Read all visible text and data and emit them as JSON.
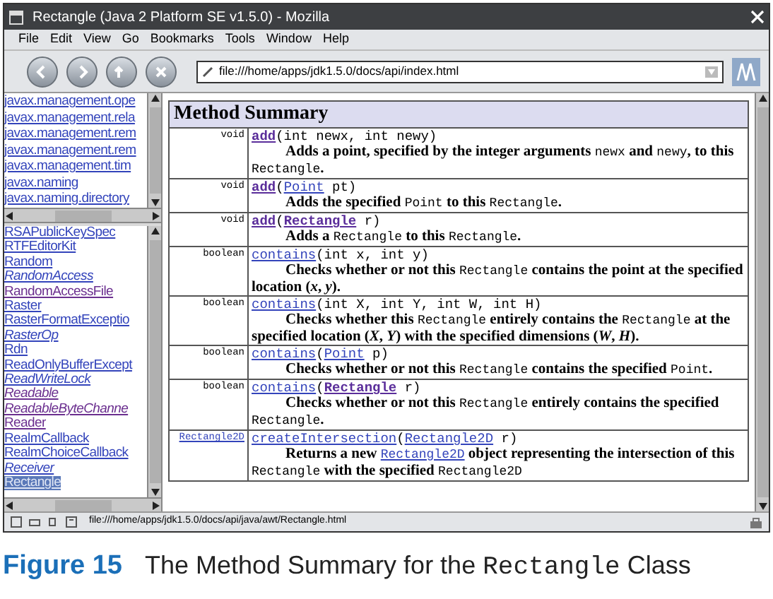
{
  "window": {
    "title": "Rectangle (Java 2 Platform SE v1.5.0) - Mozilla"
  },
  "menu": [
    "File",
    "Edit",
    "View",
    "Go",
    "Bookmarks",
    "Tools",
    "Window",
    "Help"
  ],
  "address_bar": {
    "value": "file:///home/apps/jdk1.5.0/docs/api/index.html"
  },
  "packages": [
    {
      "text": "javax.management.ope"
    },
    {
      "text": "javax.management.rela"
    },
    {
      "text": "javax.management.rem"
    },
    {
      "text": "javax.management.rem"
    },
    {
      "text": "javax.management.tim"
    },
    {
      "text": "javax.naming"
    },
    {
      "text": "javax.naming.directory"
    }
  ],
  "classes": [
    {
      "text": "RSAPublicKeySpec",
      "italic": false,
      "visited": false,
      "selected": false
    },
    {
      "text": "RTFEditorKit",
      "italic": false,
      "visited": false,
      "selected": false
    },
    {
      "text": "Random",
      "italic": false,
      "visited": false,
      "selected": false
    },
    {
      "text": "RandomAccess",
      "italic": true,
      "visited": false,
      "selected": false
    },
    {
      "text": "RandomAccessFile",
      "italic": false,
      "visited": true,
      "selected": false
    },
    {
      "text": "Raster",
      "italic": false,
      "visited": false,
      "selected": false
    },
    {
      "text": "RasterFormatExceptio",
      "italic": false,
      "visited": false,
      "selected": false
    },
    {
      "text": "RasterOp",
      "italic": true,
      "visited": false,
      "selected": false
    },
    {
      "text": "Rdn",
      "italic": false,
      "visited": false,
      "selected": false
    },
    {
      "text": "ReadOnlyBufferExcept",
      "italic": false,
      "visited": false,
      "selected": false
    },
    {
      "text": "ReadWriteLock",
      "italic": true,
      "visited": false,
      "selected": false
    },
    {
      "text": "Readable",
      "italic": true,
      "visited": true,
      "selected": false
    },
    {
      "text": "ReadableByteChanne",
      "italic": true,
      "visited": true,
      "selected": false
    },
    {
      "text": "Reader",
      "italic": false,
      "visited": true,
      "selected": false
    },
    {
      "text": "RealmCallback",
      "italic": false,
      "visited": false,
      "selected": false
    },
    {
      "text": "RealmChoiceCallback",
      "italic": false,
      "visited": false,
      "selected": false
    },
    {
      "text": "Receiver",
      "italic": true,
      "visited": false,
      "selected": false
    },
    {
      "text": "Rectangle",
      "italic": false,
      "visited": false,
      "selected": true
    }
  ],
  "method_summary": {
    "title": "Method Summary",
    "rows": [
      {
        "return_type": {
          "text": "void",
          "link": false
        },
        "signature": [
          {
            "kind": "link",
            "text": "add",
            "visited": true
          },
          {
            "kind": "code",
            "text": "(int newx, int newy)"
          }
        ],
        "description": [
          {
            "kind": "text",
            "text": "Adds a point, specified by the integer arguments"
          },
          {
            "kind": "code",
            "text": "newx"
          },
          {
            "kind": "text",
            "text": "and"
          },
          {
            "kind": "code",
            "text": "newy"
          },
          {
            "kind": "text",
            "text": ", to this"
          },
          {
            "kind": "code",
            "text": "Rectangle"
          },
          {
            "kind": "text",
            "text": "."
          }
        ]
      },
      {
        "return_type": {
          "text": "void",
          "link": false
        },
        "signature": [
          {
            "kind": "link",
            "text": "add",
            "visited": true
          },
          {
            "kind": "code",
            "text": "("
          },
          {
            "kind": "link",
            "text": "Point",
            "visited": false
          },
          {
            "kind": "code",
            "text": " pt)"
          }
        ],
        "description": [
          {
            "kind": "text",
            "text": "Adds the specified"
          },
          {
            "kind": "code",
            "text": "Point"
          },
          {
            "kind": "text",
            "text": "to this"
          },
          {
            "kind": "code",
            "text": "Rectangle"
          },
          {
            "kind": "text",
            "text": "."
          }
        ]
      },
      {
        "return_type": {
          "text": "void",
          "link": false
        },
        "signature": [
          {
            "kind": "link",
            "text": "add",
            "visited": true
          },
          {
            "kind": "code",
            "text": "("
          },
          {
            "kind": "link",
            "text": "Rectangle",
            "visited": true
          },
          {
            "kind": "code",
            "text": " r)"
          }
        ],
        "description": [
          {
            "kind": "text",
            "text": "Adds a"
          },
          {
            "kind": "code",
            "text": "Rectangle"
          },
          {
            "kind": "text",
            "text": "to this"
          },
          {
            "kind": "code",
            "text": "Rectangle"
          },
          {
            "kind": "text",
            "text": "."
          }
        ]
      },
      {
        "return_type": {
          "text": "boolean",
          "link": false
        },
        "signature": [
          {
            "kind": "link",
            "text": "contains",
            "visited": false
          },
          {
            "kind": "code",
            "text": "(int x, int y)"
          }
        ],
        "description": [
          {
            "kind": "text",
            "text": "Checks whether or not this"
          },
          {
            "kind": "code",
            "text": "Rectangle"
          },
          {
            "kind": "text",
            "text": "contains the point at the specified location (*x*, *y*)."
          }
        ]
      },
      {
        "return_type": {
          "text": "boolean",
          "link": false
        },
        "signature": [
          {
            "kind": "link",
            "text": "contains",
            "visited": false
          },
          {
            "kind": "code",
            "text": "(int X, int Y, int W, int H)"
          }
        ],
        "description": [
          {
            "kind": "text",
            "text": "Checks whether this"
          },
          {
            "kind": "code",
            "text": "Rectangle"
          },
          {
            "kind": "text",
            "text": "entirely contains the"
          },
          {
            "kind": "code",
            "text": "Rectangle"
          },
          {
            "kind": "text",
            "text": "at the specified location (*X*, *Y*) with the specified dimensions (*W*, *H*)."
          }
        ]
      },
      {
        "return_type": {
          "text": "boolean",
          "link": false
        },
        "signature": [
          {
            "kind": "link",
            "text": "contains",
            "visited": false
          },
          {
            "kind": "code",
            "text": "("
          },
          {
            "kind": "link",
            "text": "Point",
            "visited": false
          },
          {
            "kind": "code",
            "text": " p)"
          }
        ],
        "description": [
          {
            "kind": "text",
            "text": "Checks whether or not this"
          },
          {
            "kind": "code",
            "text": "Rectangle"
          },
          {
            "kind": "text",
            "text": "contains the specified"
          },
          {
            "kind": "code",
            "text": "Point"
          },
          {
            "kind": "text",
            "text": "."
          }
        ]
      },
      {
        "return_type": {
          "text": "boolean",
          "link": false
        },
        "signature": [
          {
            "kind": "link",
            "text": "contains",
            "visited": false
          },
          {
            "kind": "code",
            "text": "("
          },
          {
            "kind": "link",
            "text": "Rectangle",
            "visited": true
          },
          {
            "kind": "code",
            "text": " r)"
          }
        ],
        "description": [
          {
            "kind": "text",
            "text": "Checks whether or not this"
          },
          {
            "kind": "code",
            "text": "Rectangle"
          },
          {
            "kind": "text",
            "text": "entirely contains the specified"
          },
          {
            "kind": "code",
            "text": "Rectangle"
          },
          {
            "kind": "text",
            "text": "."
          }
        ]
      },
      {
        "return_type": {
          "text": "Rectangle2D",
          "link": true
        },
        "signature": [
          {
            "kind": "link",
            "text": "createIntersection",
            "visited": false
          },
          {
            "kind": "code",
            "text": "("
          },
          {
            "kind": "link",
            "text": "Rectangle2D",
            "visited": false
          },
          {
            "kind": "code",
            "text": " r)"
          }
        ],
        "description": [
          {
            "kind": "text",
            "text": "Returns a new"
          },
          {
            "kind": "link",
            "text": "Rectangle2D",
            "visited": false
          },
          {
            "kind": "text",
            "text": "object representing the intersection of this"
          },
          {
            "kind": "code",
            "text": "Rectangle"
          },
          {
            "kind": "text",
            "text": "with the specified"
          },
          {
            "kind": "code",
            "text": "Rectangle2D"
          }
        ]
      }
    ]
  },
  "status_bar": {
    "text": "file:///home/apps/jdk1.5.0/docs/api/java/awt/Rectangle.html"
  },
  "caption": {
    "label": "Figure 15",
    "segments": [
      {
        "kind": "text",
        "text": "The Method Summary for the"
      },
      {
        "kind": "code",
        "text": "Rectangle"
      },
      {
        "kind": "text",
        "text": "Class"
      }
    ]
  }
}
